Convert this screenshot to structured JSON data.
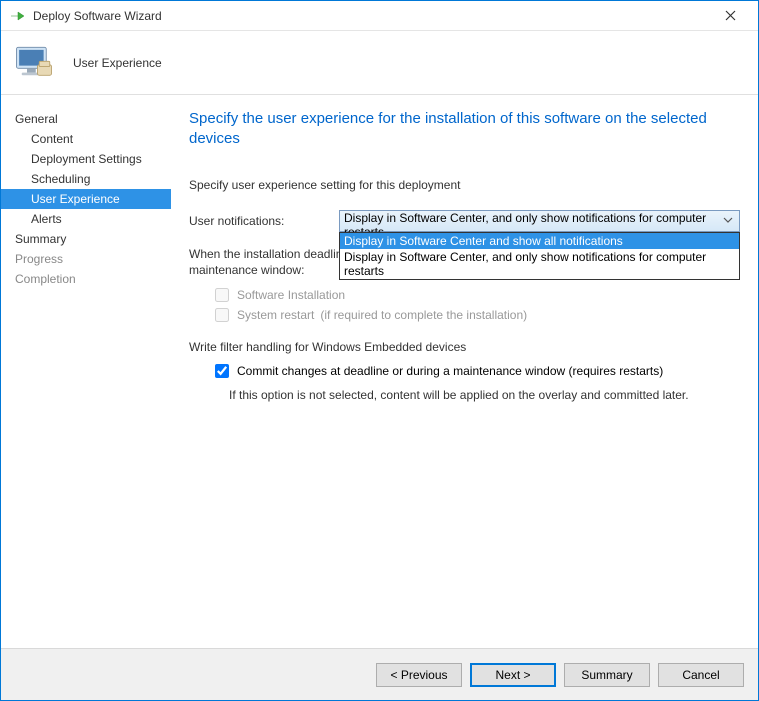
{
  "window": {
    "title": "Deploy Software Wizard"
  },
  "header": {
    "subtitle": "User Experience"
  },
  "sidebar": {
    "items": [
      {
        "label": "General",
        "child": false
      },
      {
        "label": "Content",
        "child": true
      },
      {
        "label": "Deployment Settings",
        "child": true
      },
      {
        "label": "Scheduling",
        "child": true
      },
      {
        "label": "User Experience",
        "child": true,
        "selected": true
      },
      {
        "label": "Alerts",
        "child": true
      },
      {
        "label": "Summary",
        "child": false
      },
      {
        "label": "Progress",
        "child": false,
        "muted": true
      },
      {
        "label": "Completion",
        "child": false,
        "muted": true
      }
    ]
  },
  "main": {
    "heading": "Specify the user experience for the installation of this software on the selected devices",
    "intro": "Specify user experience setting for this deployment",
    "notify_label": "User notifications:",
    "notify_value": "Display in Software Center, and only show notifications for computer restarts",
    "notify_options": [
      "Display in Software Center and show all notifications",
      "Display in Software Center, and only show notifications for computer restarts"
    ],
    "deadline_text": "When the installation deadline is reached, allow the following activities to be performed outside the maintenance window:",
    "cb_install": "Software Installation",
    "cb_restart": "System restart",
    "cb_restart_hint": "(if required to complete the installation)",
    "filter_heading": "Write filter handling for Windows Embedded devices",
    "cb_commit": "Commit changes at deadline or during a maintenance window (requires restarts)",
    "commit_note": "If this option is not selected, content will be applied on the overlay and committed later."
  },
  "footer": {
    "previous": "< Previous",
    "next": "Next >",
    "summary": "Summary",
    "cancel": "Cancel"
  }
}
